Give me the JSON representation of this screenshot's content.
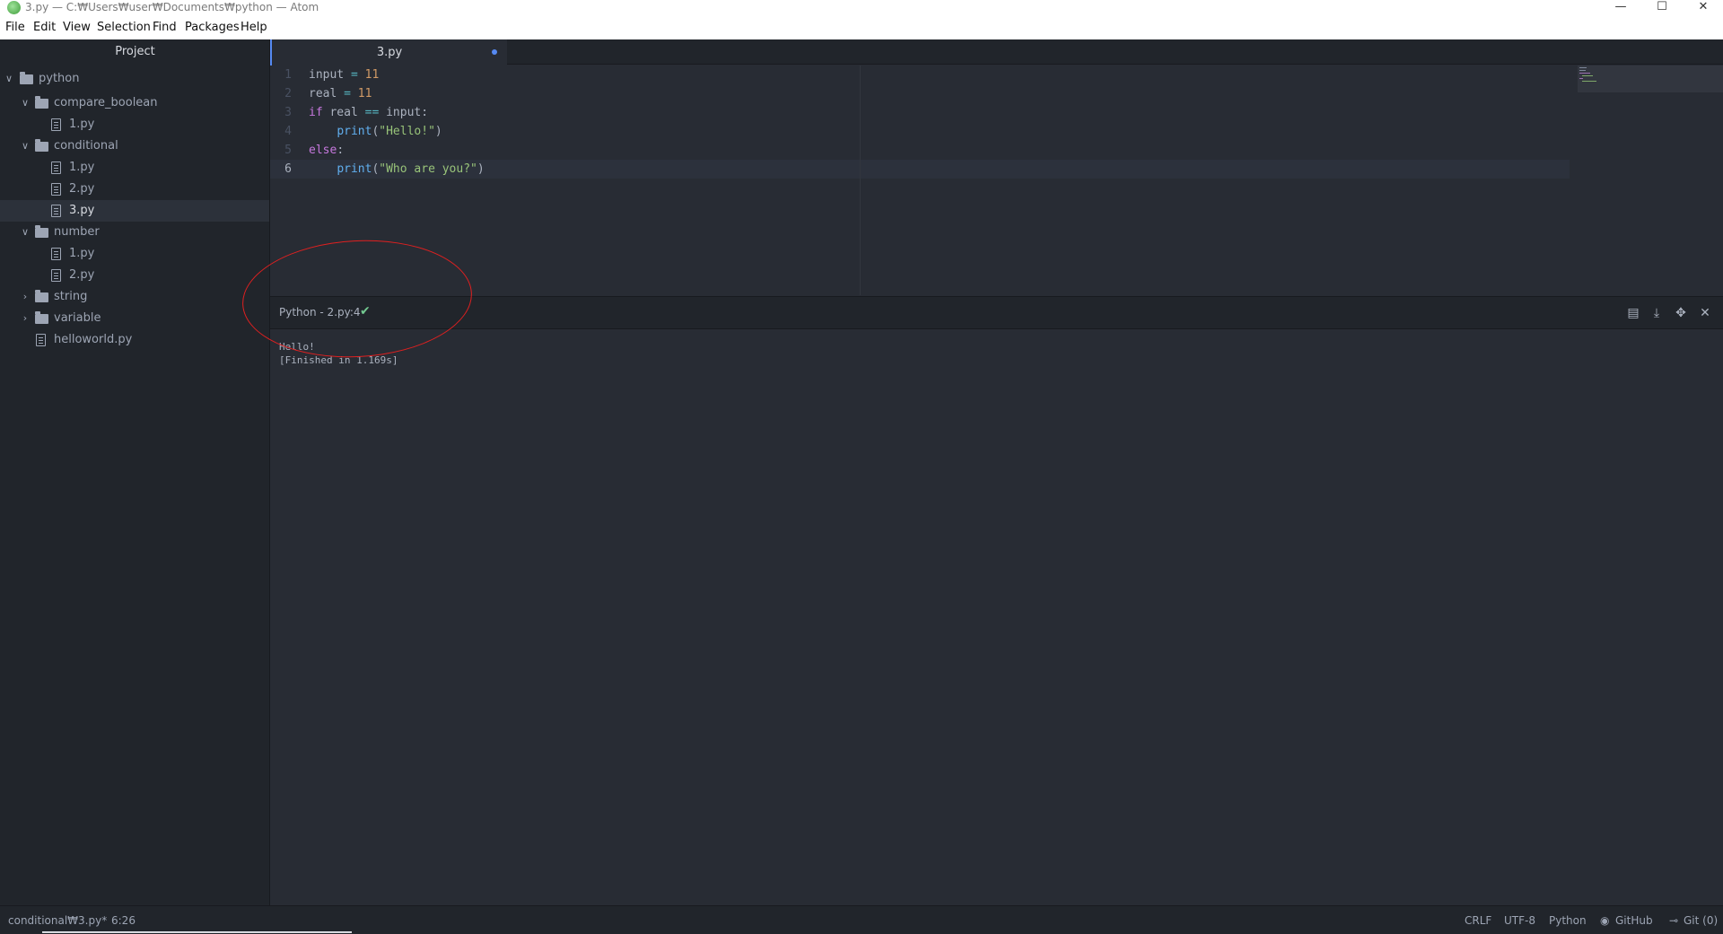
{
  "window": {
    "title": "3.py — C:₩Users₩user₩Documents₩python — Atom",
    "controls": {
      "minimize": "—",
      "maximize": "☐",
      "close": "✕"
    }
  },
  "menu": [
    "File",
    "Edit",
    "View",
    "Selection",
    "Find",
    "Packages",
    "Help"
  ],
  "tree": {
    "header": "Project",
    "root": "python",
    "items": [
      {
        "label": "compare_boolean"
      },
      {
        "label": "1.py"
      },
      {
        "label": "conditional"
      },
      {
        "label": "1.py"
      },
      {
        "label": "2.py"
      },
      {
        "label": "3.py",
        "selected": true
      },
      {
        "label": "number"
      },
      {
        "label": "1.py"
      },
      {
        "label": "2.py"
      },
      {
        "label": "string"
      },
      {
        "label": "variable"
      },
      {
        "label": "helloworld.py"
      }
    ]
  },
  "tab": {
    "label": "3.py",
    "modified": true
  },
  "code": {
    "line_numbers": [
      "1",
      "2",
      "3",
      "4",
      "5",
      "6"
    ],
    "lines": [
      "input = 11",
      "real = 11",
      "if real == input:",
      "    print(\"Hello!\")",
      "else:",
      "    print(\"Who are you?\")"
    ],
    "tokens": {
      "l1": {
        "a": "input ",
        "b": "=",
        "c": " ",
        "d": "11"
      },
      "l2": {
        "a": "real ",
        "b": "=",
        "c": " ",
        "d": "11"
      },
      "l3": {
        "a": "if",
        "b": " real ",
        "c": "==",
        "d": " input:"
      },
      "l4": {
        "a": "    ",
        "b": "print",
        "c": "(",
        "d": "\"Hello!\"",
        "e": ")"
      },
      "l5": {
        "a": "else",
        "b": ":"
      },
      "l6": {
        "a": "    ",
        "b": "print",
        "c": "(",
        "d": "\"Who are you?\"",
        "e": ")"
      }
    }
  },
  "panel": {
    "title": "Python - 2.py:4",
    "status_icon": "check-icon",
    "output": [
      "Hello!",
      "[Finished in 1.169s]"
    ],
    "buttons": [
      "copy-icon",
      "download-icon",
      "resize-icon",
      "close-icon"
    ]
  },
  "statusbar": {
    "path": "conditional₩3.py*",
    "cursor": "6:26",
    "line_ending": "CRLF",
    "encoding": "UTF-8",
    "grammar": "Python",
    "github": "GitHub",
    "git": "Git (0)"
  },
  "colors": {
    "accent": "#568af2",
    "success": "#73c990",
    "annotation": "#e02020"
  }
}
